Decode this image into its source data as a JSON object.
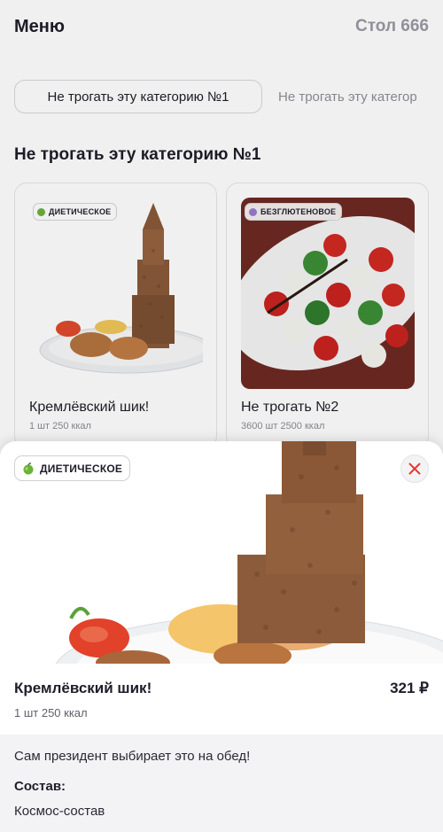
{
  "header": {
    "title": "Меню",
    "table": "Стол 666"
  },
  "categories": [
    {
      "label": "Не трогать эту категорию №1",
      "active": true
    },
    {
      "label": "Не трогать эту категор",
      "active": false
    }
  ],
  "section": {
    "title": "Не трогать эту категорию №1"
  },
  "cards": [
    {
      "name": "Кремлёвский шик!",
      "meta": "1 шт 250 ккал",
      "badge": "ДИЕТИЧЕСКОЕ",
      "badge_icon": "apple-icon"
    },
    {
      "name": "Не трогать №2",
      "meta": "3600 шт 2500 ккал",
      "badge": "БЕЗГЛЮТЕНОВОЕ",
      "badge_icon": "wheat-icon"
    }
  ],
  "detail": {
    "badge": "ДИЕТИЧЕСКОЕ",
    "badge_icon": "apple-icon",
    "name": "Кремлёвский шик!",
    "price": "321 ₽",
    "meta": "1 шт 250 ккал",
    "description": "Сам президент выбирает это на обед!",
    "composition_label": "Состав:",
    "composition": "Космос-состав"
  },
  "colors": {
    "accent_close": "#e53935",
    "diet_green": "#6bb23a",
    "gluten_purple": "#9a7bd0"
  }
}
